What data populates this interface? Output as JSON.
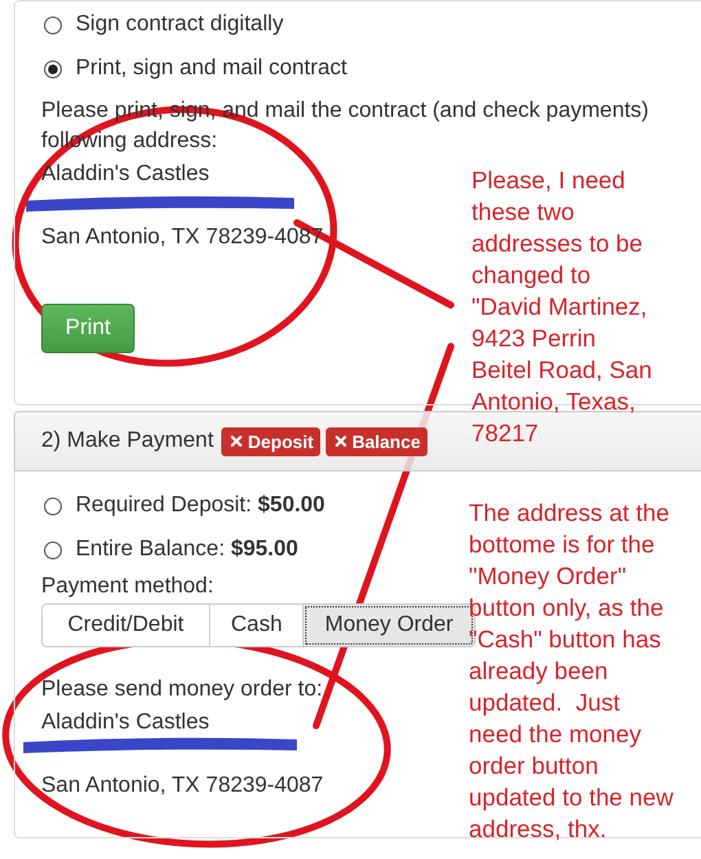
{
  "contract": {
    "options": [
      {
        "label": "Sign contract digitally",
        "selected": false
      },
      {
        "label": "Print, sign and mail contract",
        "selected": true
      }
    ],
    "instructions": [
      "Please print, sign, and mail the contract (and check payments)",
      "following address:"
    ],
    "address": [
      "Aladdin's Castles",
      "San Antonio, TX 78239-4087"
    ],
    "print_button": "Print"
  },
  "payment": {
    "header": "2) Make Payment",
    "badges": [
      {
        "label": "Deposit"
      },
      {
        "label": "Balance"
      }
    ],
    "amounts": [
      {
        "label": "Required Deposit: ",
        "amount": "$50.00",
        "selected": false
      },
      {
        "label": "Entire Balance: ",
        "amount": "$95.00",
        "selected": false
      }
    ],
    "method_label": "Payment method:",
    "methods": [
      {
        "label": "Credit/Debit",
        "selected": false
      },
      {
        "label": "Cash",
        "selected": false
      },
      {
        "label": "Money Order",
        "selected": true
      }
    ],
    "send_to": "Please send money order to:",
    "address": [
      "Aladdin's Castles",
      "San Antonio, TX 78239-4087"
    ]
  },
  "annotations": {
    "notes": [
      "Please, I need\nthese two\naddresses to be\nchanged to\n\"David Martinez,\n9423 Perrin\nBeitel Road, San\nAntonio, Texas,\n78217",
      "The address at the\nbottome is for the\n\"Money Order\"\nbutton only, as the\n\"Cash\" button has\nalready been\nupdated.  Just\nneed the money\norder button\nupdated to the new\naddress, thx."
    ]
  }
}
